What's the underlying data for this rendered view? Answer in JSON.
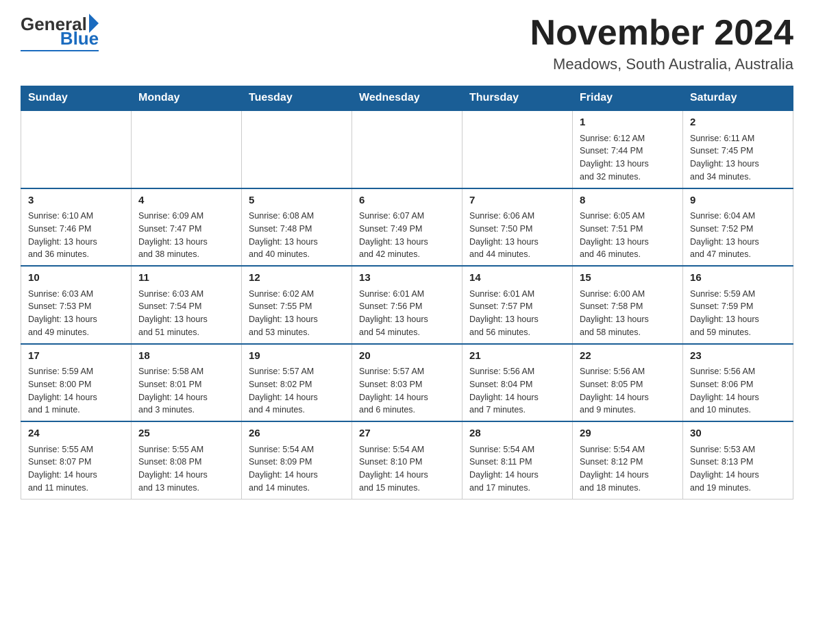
{
  "logo": {
    "general": "General",
    "blue": "Blue"
  },
  "header": {
    "title": "November 2024",
    "subtitle": "Meadows, South Australia, Australia"
  },
  "weekdays": [
    "Sunday",
    "Monday",
    "Tuesday",
    "Wednesday",
    "Thursday",
    "Friday",
    "Saturday"
  ],
  "weeks": [
    [
      {
        "day": "",
        "info": ""
      },
      {
        "day": "",
        "info": ""
      },
      {
        "day": "",
        "info": ""
      },
      {
        "day": "",
        "info": ""
      },
      {
        "day": "",
        "info": ""
      },
      {
        "day": "1",
        "info": "Sunrise: 6:12 AM\nSunset: 7:44 PM\nDaylight: 13 hours\nand 32 minutes."
      },
      {
        "day": "2",
        "info": "Sunrise: 6:11 AM\nSunset: 7:45 PM\nDaylight: 13 hours\nand 34 minutes."
      }
    ],
    [
      {
        "day": "3",
        "info": "Sunrise: 6:10 AM\nSunset: 7:46 PM\nDaylight: 13 hours\nand 36 minutes."
      },
      {
        "day": "4",
        "info": "Sunrise: 6:09 AM\nSunset: 7:47 PM\nDaylight: 13 hours\nand 38 minutes."
      },
      {
        "day": "5",
        "info": "Sunrise: 6:08 AM\nSunset: 7:48 PM\nDaylight: 13 hours\nand 40 minutes."
      },
      {
        "day": "6",
        "info": "Sunrise: 6:07 AM\nSunset: 7:49 PM\nDaylight: 13 hours\nand 42 minutes."
      },
      {
        "day": "7",
        "info": "Sunrise: 6:06 AM\nSunset: 7:50 PM\nDaylight: 13 hours\nand 44 minutes."
      },
      {
        "day": "8",
        "info": "Sunrise: 6:05 AM\nSunset: 7:51 PM\nDaylight: 13 hours\nand 46 minutes."
      },
      {
        "day": "9",
        "info": "Sunrise: 6:04 AM\nSunset: 7:52 PM\nDaylight: 13 hours\nand 47 minutes."
      }
    ],
    [
      {
        "day": "10",
        "info": "Sunrise: 6:03 AM\nSunset: 7:53 PM\nDaylight: 13 hours\nand 49 minutes."
      },
      {
        "day": "11",
        "info": "Sunrise: 6:03 AM\nSunset: 7:54 PM\nDaylight: 13 hours\nand 51 minutes."
      },
      {
        "day": "12",
        "info": "Sunrise: 6:02 AM\nSunset: 7:55 PM\nDaylight: 13 hours\nand 53 minutes."
      },
      {
        "day": "13",
        "info": "Sunrise: 6:01 AM\nSunset: 7:56 PM\nDaylight: 13 hours\nand 54 minutes."
      },
      {
        "day": "14",
        "info": "Sunrise: 6:01 AM\nSunset: 7:57 PM\nDaylight: 13 hours\nand 56 minutes."
      },
      {
        "day": "15",
        "info": "Sunrise: 6:00 AM\nSunset: 7:58 PM\nDaylight: 13 hours\nand 58 minutes."
      },
      {
        "day": "16",
        "info": "Sunrise: 5:59 AM\nSunset: 7:59 PM\nDaylight: 13 hours\nand 59 minutes."
      }
    ],
    [
      {
        "day": "17",
        "info": "Sunrise: 5:59 AM\nSunset: 8:00 PM\nDaylight: 14 hours\nand 1 minute."
      },
      {
        "day": "18",
        "info": "Sunrise: 5:58 AM\nSunset: 8:01 PM\nDaylight: 14 hours\nand 3 minutes."
      },
      {
        "day": "19",
        "info": "Sunrise: 5:57 AM\nSunset: 8:02 PM\nDaylight: 14 hours\nand 4 minutes."
      },
      {
        "day": "20",
        "info": "Sunrise: 5:57 AM\nSunset: 8:03 PM\nDaylight: 14 hours\nand 6 minutes."
      },
      {
        "day": "21",
        "info": "Sunrise: 5:56 AM\nSunset: 8:04 PM\nDaylight: 14 hours\nand 7 minutes."
      },
      {
        "day": "22",
        "info": "Sunrise: 5:56 AM\nSunset: 8:05 PM\nDaylight: 14 hours\nand 9 minutes."
      },
      {
        "day": "23",
        "info": "Sunrise: 5:56 AM\nSunset: 8:06 PM\nDaylight: 14 hours\nand 10 minutes."
      }
    ],
    [
      {
        "day": "24",
        "info": "Sunrise: 5:55 AM\nSunset: 8:07 PM\nDaylight: 14 hours\nand 11 minutes."
      },
      {
        "day": "25",
        "info": "Sunrise: 5:55 AM\nSunset: 8:08 PM\nDaylight: 14 hours\nand 13 minutes."
      },
      {
        "day": "26",
        "info": "Sunrise: 5:54 AM\nSunset: 8:09 PM\nDaylight: 14 hours\nand 14 minutes."
      },
      {
        "day": "27",
        "info": "Sunrise: 5:54 AM\nSunset: 8:10 PM\nDaylight: 14 hours\nand 15 minutes."
      },
      {
        "day": "28",
        "info": "Sunrise: 5:54 AM\nSunset: 8:11 PM\nDaylight: 14 hours\nand 17 minutes."
      },
      {
        "day": "29",
        "info": "Sunrise: 5:54 AM\nSunset: 8:12 PM\nDaylight: 14 hours\nand 18 minutes."
      },
      {
        "day": "30",
        "info": "Sunrise: 5:53 AM\nSunset: 8:13 PM\nDaylight: 14 hours\nand 19 minutes."
      }
    ]
  ]
}
